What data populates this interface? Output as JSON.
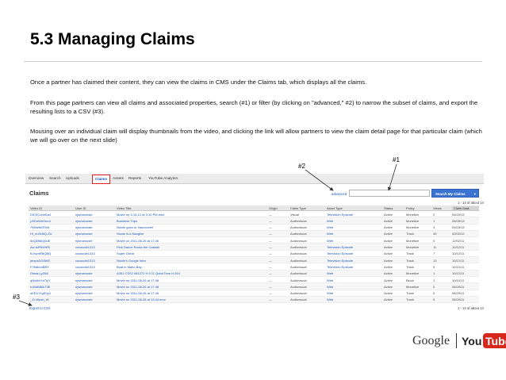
{
  "slide": {
    "title": "5.3 Managing Claims",
    "paragraphs": [
      "Once a partner has claimed their content, they can view the claims in CMS under the Claims tab, which displays all the claims.",
      "From this page partners can view all claims and associated properties, search (#1) or filter (by clicking on \"advanced,\" #2) to narrow the subset of claims, and export the resulting lists to a CSV (#3).",
      "Mousing over an individual claim will display thumbnails from the video, and clicking the link will allow partners to view the claim detail page for that particular claim (which we will go over on the next slide)"
    ],
    "callouts": {
      "c1": "#1",
      "c2": "#2",
      "c3": "#3"
    }
  },
  "cms": {
    "tabs": [
      "Overview",
      "Search",
      "Uploads",
      "Claims",
      "Assets",
      "Reports",
      "YouTube Analytics"
    ],
    "active_tab": "Claims",
    "heading": "Claims",
    "advanced_link": "advanced",
    "search_value": "",
    "search_button": "Search My Claims",
    "pager_top": "1 - 14 of about 14",
    "pager_bottom": "1 - 14 of about 14",
    "export_link": "Export to CSV",
    "columns": [
      "Video ID",
      "User ID",
      "Video Title",
      "Origin",
      "Claim Type",
      "Asset Type",
      "Status",
      "Policy",
      "Views",
      "Claim Date"
    ],
    "sorted_column": "Claim Date",
    "rows": [
      [
        "DlCKCuhdSa4",
        "njsmarcuste",
        "Movie on 3-15-12 at 3.10 PM.mov",
        "—",
        "Visual",
        "Television Episode",
        "Active",
        "Monetize",
        "2",
        "04/20/13"
      ],
      [
        "j-BDoWnGun4",
        "njsmarcuste",
        "Business Trips",
        "—",
        "Audiovisual",
        "Web",
        "Active",
        "Monetize",
        "1",
        "04/05/13"
      ],
      [
        "7WNzfkSFdzl",
        "njsmarcuste",
        "Nicole goes to Vancouver!",
        "—",
        "Audiovisual",
        "Web",
        "Active",
        "Monetize",
        "3",
        "04/03/13"
      ],
      [
        "Hl_nU5d6Q-ZU",
        "njsmarcuste",
        "Nicole is a Naughie",
        "—",
        "Audiovisual",
        "Web",
        "Active",
        "Track",
        "49",
        "02/02/12"
      ],
      [
        "5oQ5f6kQ6uE",
        "njsmarcuste",
        "Movie on 2011-08-26 at 17:46",
        "—",
        "Audiovisual",
        "Web",
        "Active",
        "Monetize",
        "0",
        "12/02/11"
      ],
      [
        "Aw-lsPNW9Rl",
        "cocacole1313",
        "Pink Dance Rocks the Casbah",
        "—",
        "Audiovisual",
        "Television Episode",
        "Active",
        "Monetize",
        "11",
        "10/12/11"
      ],
      [
        "fLHqmRBQBQ",
        "cocacole1313",
        "Super Great",
        "—",
        "Audiovisual",
        "Television Episode",
        "Active",
        "Track",
        "7",
        "10/12/11"
      ],
      [
        "jmzpsDG6WE",
        "cocacole1313",
        "Nicole's Google Intro",
        "—",
        "Audiovisual",
        "Television Episode",
        "Active",
        "Track",
        "13",
        "10/12/11"
      ],
      [
        "PJ5dbonBBY",
        "cocacole1313",
        "Boat in Maho Bay",
        "—",
        "Audiovisual",
        "Television Episode",
        "Active",
        "Track",
        "9",
        "10/12/11"
      ],
      [
        "Owsa-LyZ6A",
        "njsmarcuste",
        "A351 CSS2 081272 H.9 11 QuickTime H.264",
        "—",
        "Audiovisual",
        "Web",
        "Active",
        "Monetize",
        "1",
        "10/12/11"
      ],
      [
        "qNw5s7mTiyY",
        "njsmarcuste",
        "Movie on 2011-08-26 at 17:48",
        "—",
        "Audiovisual",
        "Web",
        "Active",
        "Block",
        "1",
        "10/10/11"
      ],
      [
        "hJBdB8kkT3E",
        "njsmarcuste",
        "Movie on 2011-08-26 at 17:48",
        "—",
        "Audiovisual",
        "Web",
        "Active",
        "Monetize",
        "0",
        "08/29/11"
      ],
      [
        "uKEUYrgS0y4",
        "njsmarcuste",
        "Movie on 2011-08-26 at 17:46",
        "—",
        "Audiovisual",
        "Web",
        "Active",
        "Track",
        "0",
        "08/29/11"
      ],
      [
        "_Zr-Wpsh_W",
        "njsmarcuste",
        "Movie on 2011-08-28 at 13:44.mov",
        "—",
        "Audiovisual",
        "Web",
        "Active",
        "Track",
        "9",
        "08/29/11"
      ]
    ]
  },
  "branding": {
    "google": "Google",
    "you": "You",
    "tube": "Tube"
  },
  "colors": {
    "accent_blue": "#3b73d0",
    "link_blue": "#1a55b5",
    "highlight_red": "#e02020",
    "youtube_red": "#d8281b"
  }
}
